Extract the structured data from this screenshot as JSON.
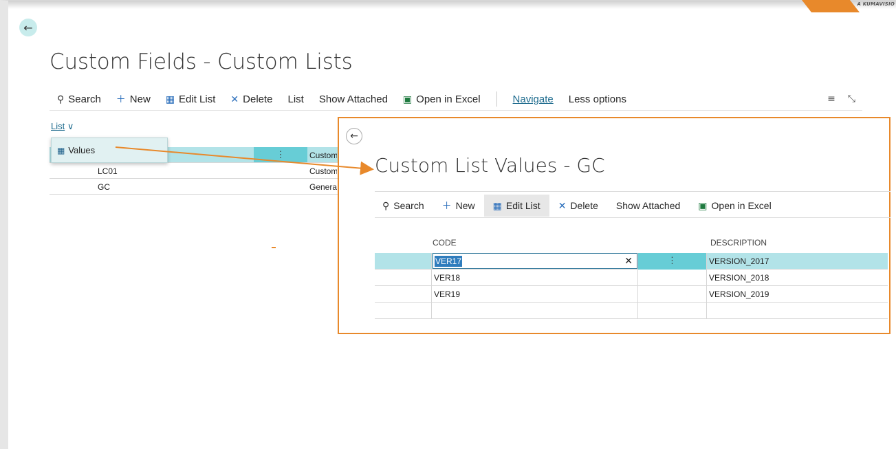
{
  "branding": {
    "text": "A KUMAVISIO"
  },
  "main": {
    "title": "Custom Fields - Custom Lists",
    "actions": {
      "search": "Search",
      "new": "New",
      "edit_list": "Edit List",
      "delete": "Delete",
      "list": "List",
      "show_attached": "Show Attached",
      "open_excel": "Open in Excel",
      "navigate": "Navigate",
      "less_options": "Less options"
    },
    "filter": {
      "label": "List"
    },
    "dropdown": {
      "item": "Values"
    },
    "rows": [
      {
        "code": "",
        "desc": "Custom"
      },
      {
        "code": "LC01",
        "desc": "Custom"
      },
      {
        "code": "GC",
        "desc": "General"
      }
    ]
  },
  "subpage": {
    "title": "Custom List Values - GC",
    "actions": {
      "search": "Search",
      "new": "New",
      "edit_list": "Edit List",
      "delete": "Delete",
      "show_attached": "Show Attached",
      "open_excel": "Open in Excel"
    },
    "columns": {
      "code": "CODE",
      "description": "DESCRIPTION"
    },
    "rows": [
      {
        "code": "VER17",
        "description": "VERSION_2017"
      },
      {
        "code": "VER18",
        "description": "VERSION_2018"
      },
      {
        "code": "VER19",
        "description": "VERSION_2019"
      },
      {
        "code": "",
        "description": ""
      }
    ]
  },
  "colors": {
    "accent": "#e8892b",
    "selected_row": "#b2e3e8",
    "cell_teal": "#67cdd6",
    "link": "#1c6a8d"
  },
  "icons": [
    "back-arrow-icon",
    "search-icon",
    "plus-icon",
    "edit-list-icon",
    "delete-x-icon",
    "excel-icon",
    "list-view-icon",
    "collapse-icon",
    "chevron-down-icon",
    "table-icon",
    "ellipsis-icon",
    "clear-icon"
  ]
}
